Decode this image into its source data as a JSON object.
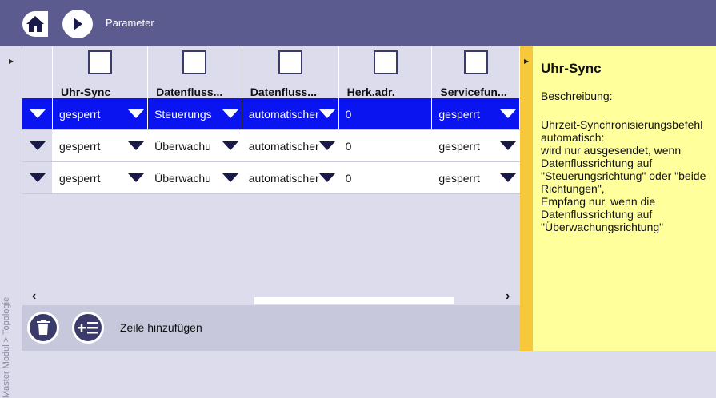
{
  "header": {
    "title": "Parameter",
    "home_icon": "home-icon",
    "forward_icon": "play-forward-icon",
    "background": "#5b5b8f"
  },
  "sidebar": {
    "breadcrumb": "Master Modul > Topologie"
  },
  "table": {
    "columns": [
      {
        "label": "Uhr-Sync"
      },
      {
        "label": "Datenfluss..."
      },
      {
        "label": "Datenfluss..."
      },
      {
        "label": "Herk.adr."
      },
      {
        "label": "Servicefun..."
      }
    ],
    "rows": [
      {
        "active": true,
        "cells": [
          "gesperrt",
          "Steuerungs",
          "automatischer",
          "0",
          "gesperrt"
        ]
      },
      {
        "active": false,
        "cells": [
          "gesperrt",
          "Überwachu",
          "automatischer",
          "0",
          "gesperrt"
        ]
      },
      {
        "active": false,
        "cells": [
          "gesperrt",
          "Überwachu",
          "automatischer",
          "0",
          "gesperrt"
        ]
      }
    ],
    "selected_row_color": "#0a14f0"
  },
  "actions": {
    "delete_icon": "trash-icon",
    "add_icon": "add-row-icon",
    "add_label": "Zeile hinzufügen"
  },
  "info_panel": {
    "title": "Uhr-Sync",
    "subtitle": "Beschreibung:",
    "text": "Uhrzeit-Synchronisierungsbefehl automatisch:\nwird nur ausgesendet, wenn Datenflussrichtung auf \"Steuerungsrichtung\" oder \"beide Richtungen\",\nEmpfang nur, wenn die Datenflussrichtung auf \"Überwachungsrichtung\"",
    "background": "#ffff9c",
    "accent": "#f6c83a"
  }
}
